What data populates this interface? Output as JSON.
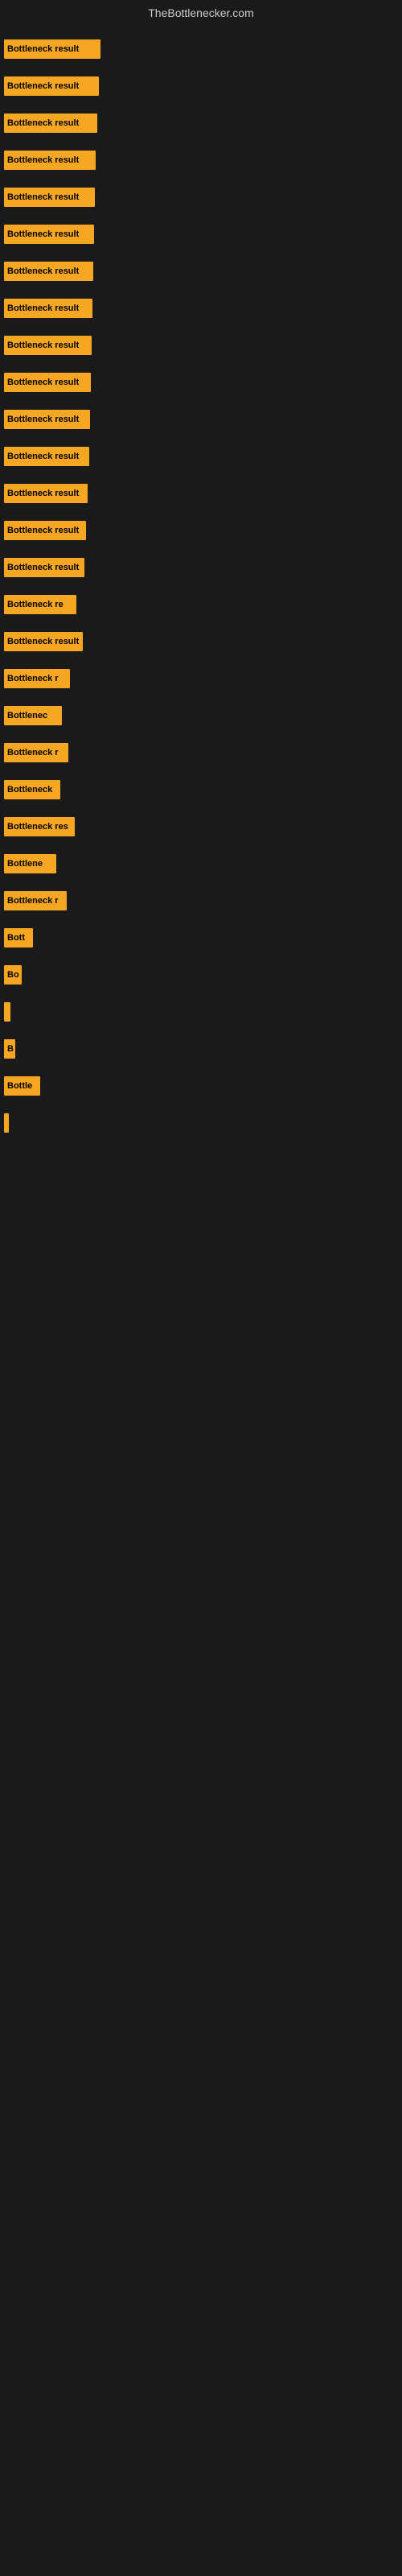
{
  "site": {
    "title": "TheBottlenecker.com"
  },
  "bars": [
    {
      "label": "Bottleneck result",
      "width": 120
    },
    {
      "label": "Bottleneck result",
      "width": 118
    },
    {
      "label": "Bottleneck result",
      "width": 116
    },
    {
      "label": "Bottleneck result",
      "width": 114
    },
    {
      "label": "Bottleneck result",
      "width": 113
    },
    {
      "label": "Bottleneck result",
      "width": 112
    },
    {
      "label": "Bottleneck result",
      "width": 111
    },
    {
      "label": "Bottleneck result",
      "width": 110
    },
    {
      "label": "Bottleneck result",
      "width": 109
    },
    {
      "label": "Bottleneck result",
      "width": 108
    },
    {
      "label": "Bottleneck result",
      "width": 107
    },
    {
      "label": "Bottleneck result",
      "width": 106
    },
    {
      "label": "Bottleneck result",
      "width": 104
    },
    {
      "label": "Bottleneck result",
      "width": 102
    },
    {
      "label": "Bottleneck result",
      "width": 100
    },
    {
      "label": "Bottleneck re",
      "width": 90
    },
    {
      "label": "Bottleneck result",
      "width": 98
    },
    {
      "label": "Bottleneck r",
      "width": 82
    },
    {
      "label": "Bottlenec",
      "width": 72
    },
    {
      "label": "Bottleneck r",
      "width": 80
    },
    {
      "label": "Bottleneck",
      "width": 70
    },
    {
      "label": "Bottleneck res",
      "width": 88
    },
    {
      "label": "Bottlene",
      "width": 65
    },
    {
      "label": "Bottleneck r",
      "width": 78
    },
    {
      "label": "Bott",
      "width": 36
    },
    {
      "label": "Bo",
      "width": 22
    },
    {
      "label": "",
      "width": 8
    },
    {
      "label": "B",
      "width": 14
    },
    {
      "label": "Bottle",
      "width": 45
    },
    {
      "label": "",
      "width": 6
    }
  ]
}
